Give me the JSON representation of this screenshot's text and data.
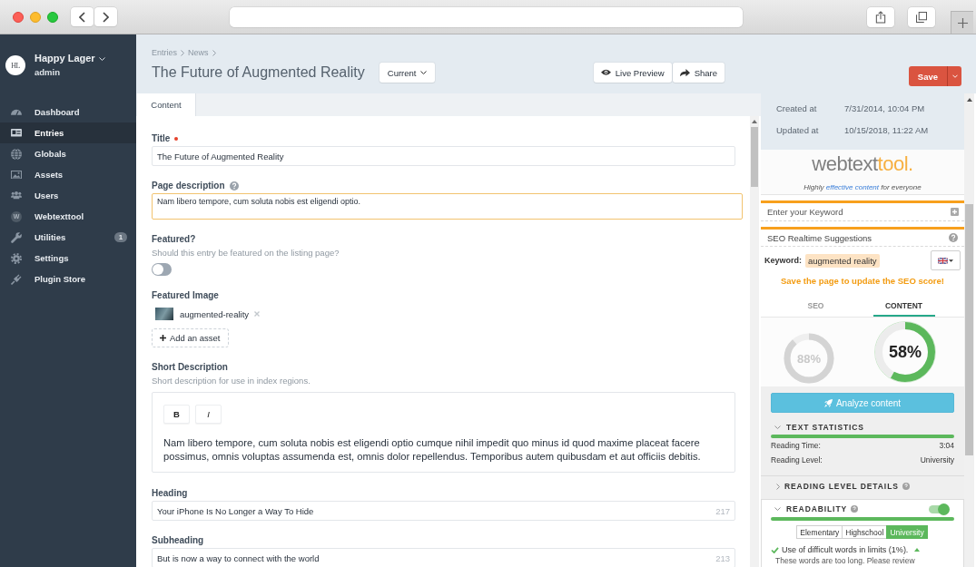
{
  "sidebar": {
    "logo": "HL",
    "site": "Happy Lager",
    "user": "admin",
    "items": [
      {
        "label": "Dashboard",
        "selected": false
      },
      {
        "label": "Entries",
        "selected": true
      },
      {
        "label": "Globals",
        "selected": false
      },
      {
        "label": "Assets",
        "selected": false
      },
      {
        "label": "Users",
        "selected": false
      },
      {
        "label": "Webtexttool",
        "selected": false,
        "icon_letter": "W"
      },
      {
        "label": "Utilities",
        "selected": false,
        "badge": "1"
      },
      {
        "label": "Settings",
        "selected": false
      },
      {
        "label": "Plugin Store",
        "selected": false
      }
    ]
  },
  "header": {
    "breadcrumbs": [
      "Entries",
      "News"
    ],
    "title": "The Future of Augmented Reality",
    "revision": "Current",
    "actions": [
      "Live Preview",
      "Share"
    ],
    "save": "Save"
  },
  "tabs": [
    {
      "label": "Content",
      "selected": true
    }
  ],
  "fields": [
    {
      "kind": "text",
      "label": "Title",
      "required": true,
      "help": false,
      "value": "The Future of Augmented Reality",
      "focused": false
    },
    {
      "kind": "textarea",
      "label": "Page description",
      "required": false,
      "help": true,
      "value": "Nam libero tempore, cum soluta nobis est eligendi optio.",
      "focused": true
    },
    {
      "kind": "toggle",
      "label": "Featured?",
      "required": false,
      "help": false,
      "instructions": "Should this entry be featured on the listing page?",
      "on": false
    },
    {
      "kind": "assets",
      "label": "Featured Image",
      "required": false,
      "help": false,
      "assets": [
        "augmented-reality"
      ],
      "add_button": "Add an asset"
    },
    {
      "kind": "richtext",
      "label": "Short Description",
      "required": false,
      "help": false,
      "instructions": "Short description for use in index regions.",
      "toolbar": [
        "B",
        "I"
      ],
      "value": "Nam libero tempore, cum soluta nobis est eligendi optio cumque nihil impedit quo minus id quod maxime placeat facere possimus, omnis voluptas assumenda est, omnis dolor repellendus. Temporibus autem quibusdam et aut officiis debitis."
    },
    {
      "kind": "text",
      "label": "Heading",
      "required": false,
      "help": false,
      "value": "Your iPhone Is No Longer a Way To Hide",
      "count": "217",
      "focused": false
    },
    {
      "kind": "text",
      "label": "Subheading",
      "required": false,
      "help": false,
      "value": "But is now a way to connect with the world",
      "count": "213",
      "focused": false
    }
  ],
  "meta": [
    {
      "label": "Created at",
      "value": "7/31/2014, 10:04 PM"
    },
    {
      "label": "Updated at",
      "value": "10/15/2018, 11:22 AM"
    }
  ],
  "seo_panel": {
    "logo": [
      "webtext",
      "tool."
    ],
    "tagline": [
      {
        "text": "Highly",
        "highlight": false
      },
      {
        "text": "effective content",
        "highlight": true
      },
      {
        "text": "for everyone",
        "highlight": false
      }
    ],
    "keyword_field": {
      "placeholder": "Enter your Keyword"
    },
    "suggestions_title": "SEO Realtime Suggestions",
    "keyword_label": "Keyword:",
    "keyword": "augmented reality",
    "notice": "Save the page to update the SEO score!",
    "tabs": [
      {
        "label": "SEO",
        "selected": false
      },
      {
        "label": "CONTENT",
        "selected": true
      }
    ],
    "scores": [
      {
        "value": "88%",
        "selected": false
      },
      {
        "value": "58%",
        "selected": true
      }
    ],
    "analyze_button": "Analyze content",
    "sections": [
      {
        "kind": "stats",
        "title": "TEXT STATISTICS",
        "expanded": true,
        "help": false,
        "level": 1,
        "rows": [
          {
            "label": "Reading Time:",
            "value": "3:04"
          },
          {
            "label": "Reading Level:",
            "value": "University"
          }
        ]
      },
      {
        "kind": "details",
        "title": "READING LEVEL DETAILS",
        "expanded": false,
        "help": true
      },
      {
        "kind": "readability",
        "title": "READABILITY",
        "expanded": true,
        "help": true,
        "on": true,
        "level": 1,
        "levels": [
          {
            "label": "Elementary",
            "selected": false
          },
          {
            "label": "Highschool",
            "selected": false
          },
          {
            "label": "University",
            "selected": true
          }
        ],
        "checks": [
          {
            "text": "Use of difficult words in limits (1%).",
            "passed": true,
            "expanded": true
          }
        ],
        "note": "These words are too long. Please review"
      }
    ]
  }
}
